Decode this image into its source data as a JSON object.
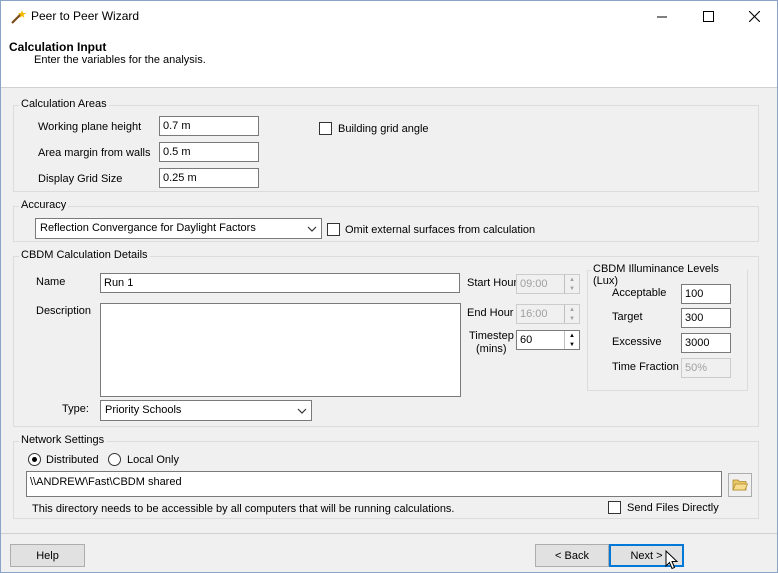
{
  "window": {
    "title": "Peer to Peer Wizard"
  },
  "header": {
    "title": "Calculation Input",
    "subtitle": "Enter the variables for the analysis."
  },
  "calc_areas": {
    "legend": "Calculation Areas",
    "working_plane_label": "Working plane height",
    "working_plane_value": "0.7 m",
    "margin_label": "Area margin from walls",
    "margin_value": "0.5 m",
    "grid_label": "Display Grid Size",
    "grid_value": "0.25 m",
    "building_grid_label": "Building grid angle",
    "building_grid_checked": false
  },
  "accuracy": {
    "legend": "Accuracy",
    "selected": "Reflection Convergance for Daylight Factors",
    "omit_label": "Omit external surfaces from calculation",
    "omit_checked": false
  },
  "cbdm": {
    "legend": "CBDM Calculation Details",
    "name_label": "Name",
    "name_value": "Run 1",
    "description_label": "Description",
    "description_value": "",
    "type_label": "Type:",
    "type_selected": "Priority Schools",
    "start_hour_label": "Start Hour",
    "start_hour_value": "09:00",
    "end_hour_label": "End Hour",
    "end_hour_value": "16:00",
    "timestep_label_1": "Timestep",
    "timestep_label_2": "(mins)",
    "timestep_value": "60"
  },
  "illuminance": {
    "legend": "CBDM Illuminance Levels (Lux)",
    "acceptable_label": "Acceptable",
    "acceptable_value": "100",
    "target_label": "Target",
    "target_value": "300",
    "excessive_label": "Excessive",
    "excessive_value": "3000",
    "time_fraction_label": "Time Fraction",
    "time_fraction_value": "50%"
  },
  "network": {
    "legend": "Network Settings",
    "distributed_label": "Distributed",
    "local_only_label": "Local Only",
    "selected_mode": "Distributed",
    "path_value": "\\\\ANDREW\\Fast\\CBDM shared",
    "note": "This directory needs to be accessible by all computers that will be running calculations.",
    "send_files_label": "Send Files Directly",
    "send_files_checked": false
  },
  "footer": {
    "help_label": "Help",
    "back_label": "< Back",
    "next_label": "Next >"
  },
  "icons": {
    "app": "magic-wand-icon",
    "folder": "folder-open-icon"
  }
}
